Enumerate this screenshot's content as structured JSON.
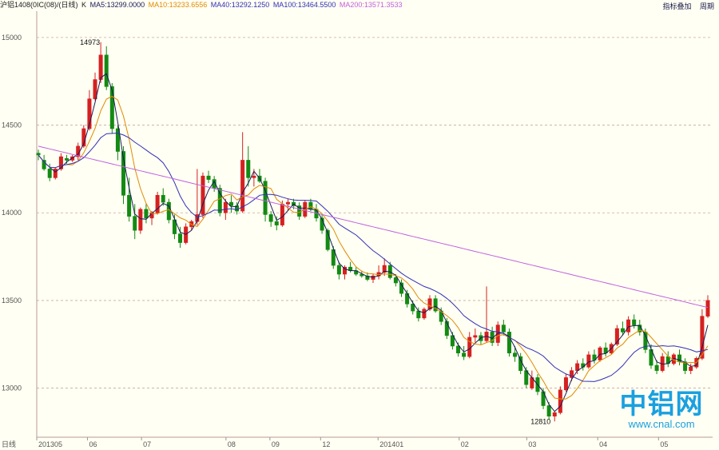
{
  "legend": {
    "symbol": "沪铝1408(0IC(08)/(日线)",
    "k": "K",
    "ma5": "MA5:13299.0000",
    "ma10": "MA10:13233.6556",
    "ma40": "MA40:13292.1250",
    "ma100": "MA100:13464.5500",
    "ma200": "MA200:13571.3533"
  },
  "right_links": [
    "指标叠加",
    "周期"
  ],
  "watermark": {
    "main": "中铝网",
    "url": "www.cnal.com"
  },
  "colors": {
    "background": "#fffff3",
    "up": "#d62020",
    "down": "#138a13",
    "ma5": "#1a1a5a",
    "ma10": "#e08a00",
    "ma40": "#3030b8",
    "ma100": "#3030b8",
    "ma200": "#c060e0",
    "grid": "#c8a8a8"
  },
  "chart_data": {
    "type": "candlestick",
    "title": "沪铝1408(0IC(08)/(日线)",
    "x_axis_label": "日线",
    "y_ticks": [
      "15000",
      "14500",
      "14000",
      "13500",
      "13000"
    ],
    "y_tick_values": [
      15000,
      14500,
      14000,
      13500,
      13000
    ],
    "x_ticks": [
      "201305",
      "06",
      "07",
      "08",
      "09",
      "12",
      "201401",
      "02",
      "03",
      "04",
      "05"
    ],
    "ylim": [
      12720,
      15150
    ],
    "annotations": [
      {
        "text": "14973",
        "value": 14973
      },
      {
        "text": "12810",
        "value": 12810
      }
    ],
    "series": [
      {
        "name": "MA5",
        "value": 13299.0
      },
      {
        "name": "MA10",
        "value": 13233.6556
      },
      {
        "name": "MA40",
        "value": 13292.125
      },
      {
        "name": "MA100",
        "value": 13464.55
      },
      {
        "name": "MA200",
        "value": 13571.3533
      }
    ],
    "ohlc_anchors": [
      [
        14340,
        14360,
        14300,
        14330
      ],
      [
        14300,
        14330,
        14240,
        14250
      ],
      [
        14250,
        14280,
        14180,
        14200
      ],
      [
        14200,
        14260,
        14190,
        14250
      ],
      [
        14250,
        14340,
        14240,
        14320
      ],
      [
        14310,
        14330,
        14280,
        14300
      ],
      [
        14300,
        14330,
        14290,
        14320
      ],
      [
        14320,
        14400,
        14300,
        14380
      ],
      [
        14380,
        14500,
        14370,
        14480
      ],
      [
        14480,
        14700,
        14470,
        14650
      ],
      [
        14650,
        14800,
        14640,
        14760
      ],
      [
        14760,
        14973,
        14740,
        14900
      ],
      [
        14900,
        14950,
        14700,
        14720
      ],
      [
        14720,
        14740,
        14450,
        14480
      ],
      [
        14480,
        14500,
        14300,
        14350
      ],
      [
        14350,
        14380,
        14050,
        14100
      ],
      [
        14100,
        14200,
        13950,
        13980
      ],
      [
        13980,
        14050,
        13850,
        13900
      ],
      [
        13900,
        14030,
        13880,
        14020
      ],
      [
        14020,
        14050,
        13940,
        13970
      ],
      [
        13970,
        14010,
        13930,
        14000
      ],
      [
        14000,
        14120,
        13990,
        14100
      ],
      [
        14100,
        14140,
        14040,
        14060
      ],
      [
        14060,
        14080,
        13940,
        13960
      ],
      [
        13960,
        13990,
        13850,
        13880
      ],
      [
        13880,
        13920,
        13800,
        13830
      ],
      [
        13830,
        13940,
        13820,
        13920
      ],
      [
        13920,
        13960,
        13900,
        13950
      ],
      [
        13950,
        14250,
        13930,
        13990
      ],
      [
        13990,
        14230,
        13970,
        14210
      ],
      [
        14210,
        14240,
        14170,
        14190
      ],
      [
        14190,
        14210,
        14120,
        14140
      ],
      [
        14140,
        14160,
        13980,
        14000
      ],
      [
        14000,
        14080,
        13960,
        14060
      ],
      [
        14060,
        14100,
        14000,
        14040
      ],
      [
        14040,
        14060,
        13990,
        14010
      ],
      [
        14010,
        14460,
        14000,
        14300
      ],
      [
        14300,
        14380,
        14150,
        14200
      ],
      [
        14200,
        14250,
        14150,
        14210
      ],
      [
        14210,
        14250,
        14170,
        14180
      ],
      [
        14180,
        14200,
        13950,
        13990
      ],
      [
        13990,
        14010,
        13920,
        13950
      ],
      [
        13950,
        13980,
        13900,
        13930
      ],
      [
        13930,
        14070,
        13920,
        14050
      ],
      [
        14050,
        14080,
        14010,
        14060
      ],
      [
        14060,
        14080,
        14020,
        14040
      ],
      [
        14040,
        14060,
        13960,
        13980
      ],
      [
        13980,
        14070,
        13970,
        14060
      ],
      [
        14060,
        14080,
        14010,
        14020
      ],
      [
        14020,
        14050,
        13950,
        13970
      ],
      [
        13970,
        13990,
        13880,
        13900
      ],
      [
        13900,
        13910,
        13780,
        13790
      ],
      [
        13790,
        13810,
        13680,
        13700
      ],
      [
        13700,
        13720,
        13620,
        13650
      ],
      [
        13650,
        13700,
        13620,
        13690
      ],
      [
        13690,
        13720,
        13660,
        13670
      ],
      [
        13670,
        13690,
        13640,
        13650
      ],
      [
        13650,
        13670,
        13630,
        13640
      ],
      [
        13640,
        13660,
        13610,
        13620
      ],
      [
        13620,
        13650,
        13600,
        13640
      ],
      [
        13640,
        13700,
        13620,
        13660
      ],
      [
        13660,
        13740,
        13640,
        13700
      ],
      [
        13700,
        13720,
        13620,
        13630
      ],
      [
        13630,
        13650,
        13580,
        13600
      ],
      [
        13600,
        13620,
        13520,
        13540
      ],
      [
        13540,
        13560,
        13460,
        13480
      ],
      [
        13480,
        13500,
        13420,
        13440
      ],
      [
        13440,
        13460,
        13380,
        13400
      ],
      [
        13400,
        13460,
        13390,
        13450
      ],
      [
        13450,
        13530,
        13440,
        13510
      ],
      [
        13510,
        13530,
        13430,
        13440
      ],
      [
        13440,
        13460,
        13360,
        13380
      ],
      [
        13380,
        13400,
        13280,
        13300
      ],
      [
        13300,
        13320,
        13220,
        13240
      ],
      [
        13240,
        13260,
        13180,
        13200
      ],
      [
        13200,
        13240,
        13160,
        13180
      ],
      [
        13180,
        13320,
        13170,
        13290
      ],
      [
        13290,
        13340,
        13260,
        13300
      ],
      [
        13300,
        13320,
        13250,
        13270
      ],
      [
        13270,
        13580,
        13260,
        13320
      ],
      [
        13320,
        13350,
        13240,
        13260
      ],
      [
        13260,
        13380,
        13240,
        13360
      ],
      [
        13360,
        13390,
        13300,
        13320
      ],
      [
        13320,
        13340,
        13180,
        13200
      ],
      [
        13200,
        13240,
        13150,
        13180
      ],
      [
        13180,
        13200,
        13080,
        13100
      ],
      [
        13100,
        13120,
        13000,
        13020
      ],
      [
        13000,
        13100,
        12990,
        13060
      ],
      [
        13060,
        13080,
        12960,
        12980
      ],
      [
        12980,
        13000,
        12880,
        12900
      ],
      [
        12900,
        12920,
        12820,
        12840
      ],
      [
        12840,
        12870,
        12810,
        12860
      ],
      [
        12860,
        13010,
        12850,
        12990
      ],
      [
        12990,
        13080,
        12980,
        13060
      ],
      [
        13060,
        13120,
        13040,
        13100
      ],
      [
        13100,
        13160,
        13080,
        13140
      ],
      [
        13140,
        13170,
        13100,
        13120
      ],
      [
        13120,
        13210,
        13110,
        13190
      ],
      [
        13190,
        13220,
        13140,
        13160
      ],
      [
        13160,
        13240,
        13150,
        13230
      ],
      [
        13230,
        13260,
        13180,
        13200
      ],
      [
        13200,
        13260,
        13190,
        13250
      ],
      [
        13250,
        13360,
        13240,
        13340
      ],
      [
        13340,
        13380,
        13300,
        13320
      ],
      [
        13320,
        13410,
        13300,
        13390
      ],
      [
        13390,
        13420,
        13340,
        13360
      ],
      [
        13360,
        13390,
        13300,
        13320
      ],
      [
        13320,
        13340,
        13200,
        13220
      ],
      [
        13220,
        13250,
        13110,
        13130
      ],
      [
        13130,
        13160,
        13080,
        13100
      ],
      [
        13100,
        13200,
        13090,
        13180
      ],
      [
        13180,
        13210,
        13120,
        13140
      ],
      [
        13140,
        13200,
        13130,
        13190
      ],
      [
        13190,
        13220,
        13130,
        13150
      ],
      [
        13150,
        13170,
        13080,
        13100
      ],
      [
        13100,
        13140,
        13080,
        13120
      ],
      [
        13120,
        13180,
        13110,
        13170
      ],
      [
        13170,
        13450,
        13160,
        13410
      ],
      [
        13410,
        13530,
        13400,
        13500
      ]
    ]
  }
}
